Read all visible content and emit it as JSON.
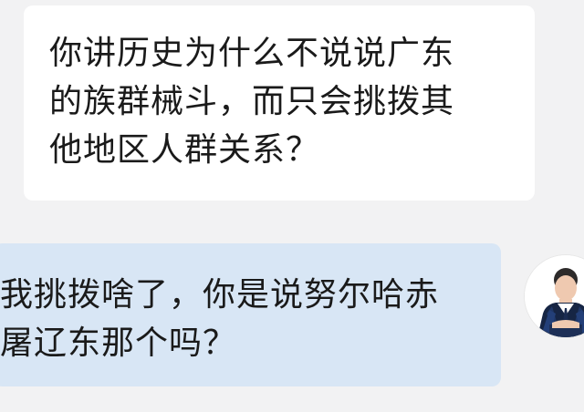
{
  "chat": {
    "messages": [
      {
        "side": "left",
        "text": "你讲历史为什么不说说广东\n的族群械斗，而只会挑拨其\n他地区人群关系？"
      },
      {
        "side": "right",
        "text": "我挑拨啥了，你是说努尔哈赤\n屠辽东那个吗？"
      }
    ]
  },
  "avatar": {
    "icon": "user-avatar-icon"
  },
  "colors": {
    "background": "#f2f2f3",
    "left_bubble": "#ffffff",
    "right_bubble": "#d8e6f5",
    "text": "#1a1a1a"
  }
}
